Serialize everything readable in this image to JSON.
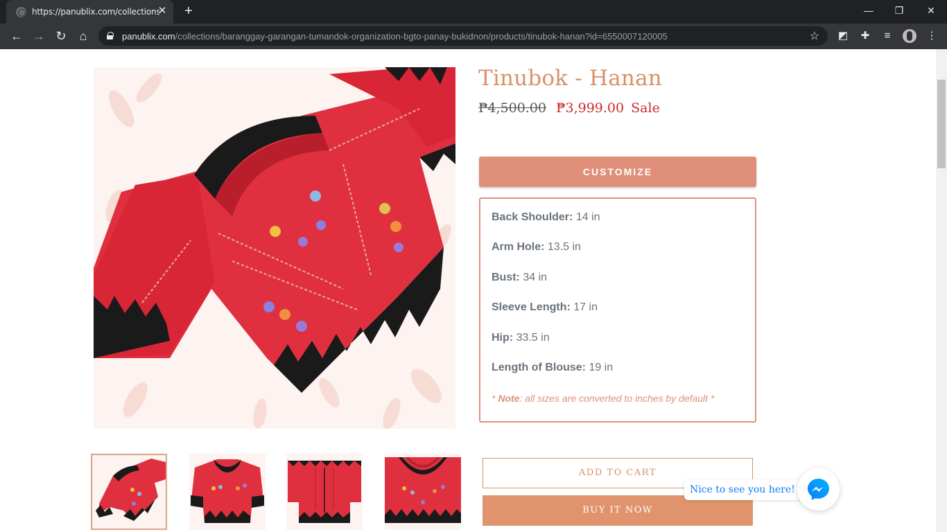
{
  "browser": {
    "tab_title": "https://panublix.com/collections/",
    "tab_close": "✕",
    "new_tab": "+",
    "url_host": "panublix.com",
    "url_path": "/collections/baranggay-garangan-tumandok-organization-bgto-panay-bukidnon/products/tinubok-hanan?id=6550007120005",
    "window_controls": {
      "minimize": "—",
      "restore": "❐",
      "close": "✕"
    },
    "nav": {
      "back": "←",
      "forward": "→",
      "reload": "↻",
      "home": "⌂"
    }
  },
  "product": {
    "title": "Tinubok - Hanan",
    "price_original": "₱4,500.00",
    "price_sale": "₱3,999.00",
    "sale_label": "Sale",
    "customize_label": "CUSTOMIZE",
    "measurements": [
      {
        "label": "Back Shoulder:",
        "value": "14 in"
      },
      {
        "label": "Arm Hole:",
        "value": "13.5 in"
      },
      {
        "label": "Bust:",
        "value": "34 in"
      },
      {
        "label": "Sleeve Length:",
        "value": "17 in"
      },
      {
        "label": "Hip:",
        "value": "33.5 in"
      },
      {
        "label": "Length of Blouse:",
        "value": "19 in"
      }
    ],
    "note_prefix": "* ",
    "note_bold": "Note",
    "note_text": ": all sizes are converted to inches by default *",
    "add_to_cart_label": "ADD TO CART",
    "buy_now_label": "BUY IT NOW"
  },
  "chat": {
    "greeting": "Nice to see you here!"
  },
  "colors": {
    "accent": "#e0907a",
    "title": "#d99066",
    "sale": "#cc2a2a",
    "blouse_red": "#e0303f",
    "trim_black": "#1a1a1a"
  }
}
